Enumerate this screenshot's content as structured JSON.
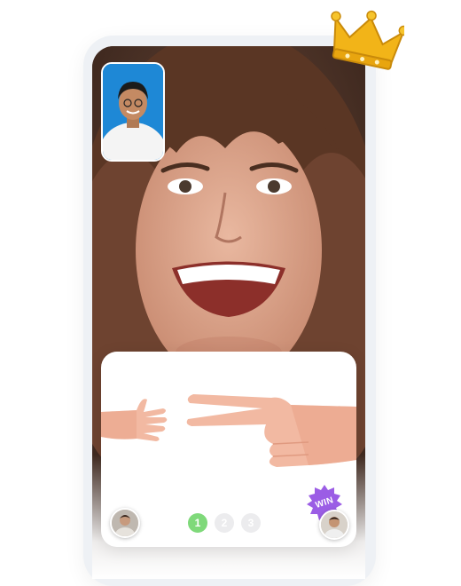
{
  "game": {
    "rounds": [
      {
        "number": "1",
        "state": "active"
      },
      {
        "number": "2",
        "state": "inactive"
      },
      {
        "number": "3",
        "state": "inactive"
      }
    ],
    "win_badge": "WIN",
    "opponent_gesture": "paper",
    "player_gesture": "scissors"
  },
  "colors": {
    "active_round": "#7fd97a",
    "inactive_round": "#ececee",
    "win_badge": "#9b5de5",
    "crown": "#f2b418",
    "self_view_background": "#1e88d6"
  },
  "icons": {
    "crown": "crown-icon",
    "hand_open": "open-hand-icon",
    "hand_scissors": "scissors-hand-icon"
  }
}
